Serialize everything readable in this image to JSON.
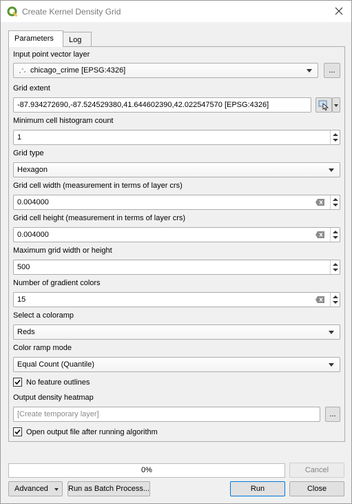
{
  "window": {
    "title": "Create Kernel Density Grid"
  },
  "tabs": [
    {
      "label": "Parameters",
      "active": true
    },
    {
      "label": "Log",
      "active": false
    }
  ],
  "params": {
    "input_layer": {
      "label": "Input point vector layer",
      "value": "chicago_crime [EPSG:4326]",
      "browse": "..."
    },
    "grid_extent": {
      "label": "Grid extent",
      "value": "-87.934272690,-87.524529380,41.644602390,42.022547570 [EPSG:4326]"
    },
    "min_cell_hist": {
      "label": "Minimum cell histogram count",
      "value": "1"
    },
    "grid_type": {
      "label": "Grid type",
      "value": "Hexagon"
    },
    "cell_width": {
      "label": "Grid cell width (measurement in terms of layer crs)",
      "value": "0.004000"
    },
    "cell_height": {
      "label": "Grid cell height (measurement in terms of layer crs)",
      "value": "0.004000"
    },
    "max_grid": {
      "label": "Maximum grid width or height",
      "value": "500"
    },
    "gradient_colors": {
      "label": "Number of gradient colors",
      "value": "15"
    },
    "colorramp": {
      "label": "Select a coloramp",
      "value": "Reds"
    },
    "ramp_mode": {
      "label": "Color ramp mode",
      "value": "Equal Count (Quantile)"
    },
    "no_outlines": {
      "label": "No feature outlines",
      "checked": true
    },
    "output": {
      "label": "Output density heatmap",
      "placeholder": "[Create temporary layer]",
      "browse": "..."
    },
    "open_output": {
      "label": "Open output file after running algorithm",
      "checked": true
    }
  },
  "progress": {
    "value": 0,
    "text": "0%"
  },
  "buttons": {
    "cancel": "Cancel",
    "advanced": "Advanced",
    "batch": "Run as Batch Process...",
    "run": "Run",
    "close": "Close"
  },
  "colors": {
    "accent": "#0078d7",
    "qgis_green": "#589632",
    "progress_fill": "#06b025"
  }
}
